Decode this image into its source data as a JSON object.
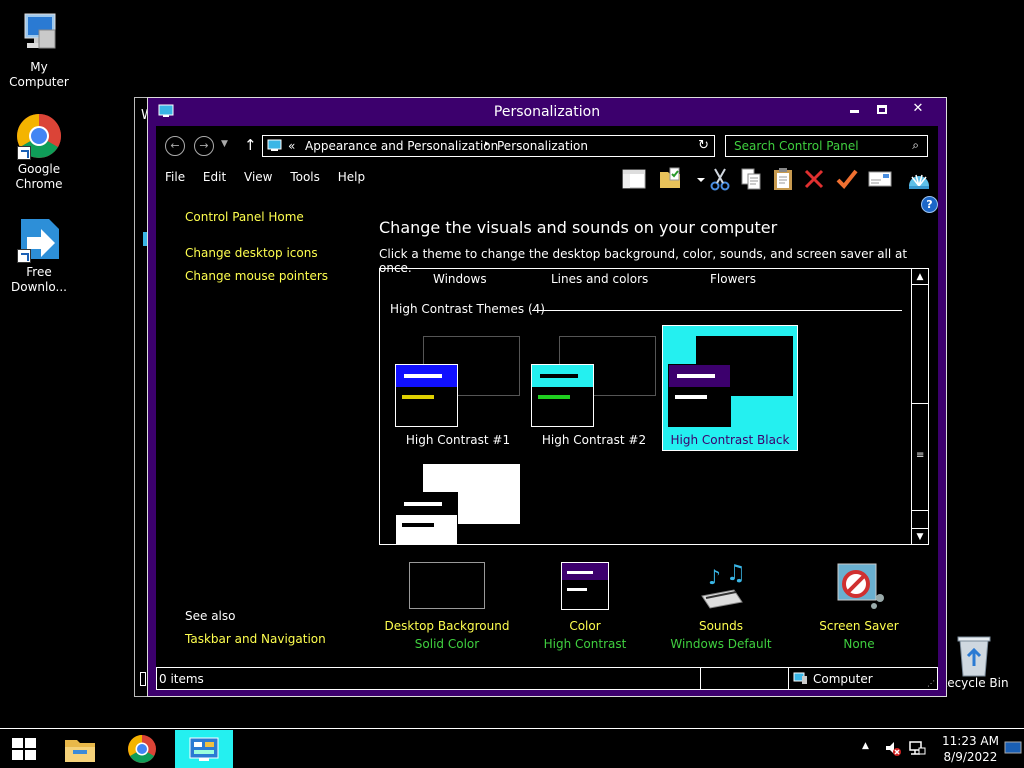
{
  "desktop": {
    "icons": [
      {
        "label": "My Computer"
      },
      {
        "label": "Google Chrome"
      },
      {
        "label": "Free Downlo..."
      },
      {
        "label": "Recycle Bin"
      }
    ]
  },
  "background_window": {
    "title_char": "W"
  },
  "window": {
    "title": "Personalization",
    "controls": {
      "close": "✕"
    }
  },
  "navbar": {
    "chevrons": "«",
    "breadcrumb": [
      "Appearance and Personalization",
      "Personalization"
    ],
    "separator": "▸",
    "refresh": "↻",
    "search_placeholder": "Search Control Panel",
    "search_icon": "⌕"
  },
  "menu": {
    "items": [
      "File",
      "Edit",
      "View",
      "Tools",
      "Help"
    ]
  },
  "toolbar": {
    "icons": [
      "layout-icon",
      "folder-options-icon",
      "dropdown-icon",
      "cut-icon",
      "copy-icon",
      "paste-icon",
      "delete-icon",
      "check-icon",
      "email-icon",
      "shell-icon"
    ],
    "help": "?"
  },
  "left_pane": {
    "home": "Control Panel Home",
    "links": [
      "Change desktop icons",
      "Change mouse pointers"
    ],
    "see_also": "See also",
    "see_also_links": [
      "Taskbar and Navigation"
    ]
  },
  "main": {
    "heading": "Change the visuals and sounds on your computer",
    "subheading": "Click a theme to change the desktop background, color, sounds, and screen saver all at once.",
    "columns": [
      "Windows",
      "Lines and colors",
      "Flowers"
    ],
    "group": "High Contrast Themes (4)",
    "themes": [
      {
        "name": "High Contrast #1",
        "header_color": "#1010ff",
        "accent_color": "#e0d000",
        "selected": false
      },
      {
        "name": "High Contrast #2",
        "header_color": "#24f0f0",
        "accent_color": "#20d020",
        "selected": false
      },
      {
        "name": "High Contrast Black",
        "header_color": "#3c006d",
        "accent_color": "#ffffff",
        "selected": true
      },
      {
        "name": "",
        "header_color": "#000000",
        "accent_color": "#000000",
        "selected": false
      }
    ]
  },
  "settings": [
    {
      "label": "Desktop Background",
      "value": "Solid Color"
    },
    {
      "label": "Color",
      "value": "High Contrast"
    },
    {
      "label": "Sounds",
      "value": "Windows Default"
    },
    {
      "label": "Screen Saver",
      "value": "None"
    }
  ],
  "statusbar": {
    "items": "0 items",
    "location": "Computer"
  },
  "taskbar": {
    "clock_time": "11:23 AM",
    "clock_date": "8/9/2022",
    "tray_arrow": "▲"
  },
  "colors": {
    "window_frame": "#3c006d",
    "link": "#ffff4f",
    "value_green": "#3fcf3f",
    "selection": "#24f0f0"
  }
}
